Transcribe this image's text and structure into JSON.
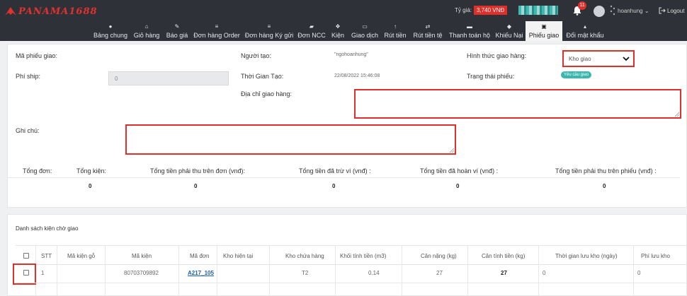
{
  "brand": {
    "name": "PANAMA1688"
  },
  "header": {
    "rate_label": "Tỷ giá:",
    "rate_value": "3,740 VNĐ",
    "notification_count": "11",
    "username": "hoanhung",
    "logout_label": "Logout"
  },
  "nav": [
    {
      "label": "Bảng chung",
      "icon": "dashboard-icon",
      "glyph": "●"
    },
    {
      "label": "Giỏ hàng",
      "icon": "basket-icon",
      "glyph": "⌂"
    },
    {
      "label": "Báo giá",
      "icon": "tag-icon",
      "glyph": "✎"
    },
    {
      "label": "Đơn hàng Order",
      "icon": "list-icon",
      "glyph": "≡"
    },
    {
      "label": "Đơn hàng Ký gửi",
      "icon": "list-icon",
      "glyph": "≡"
    },
    {
      "label": "Đơn NCC",
      "icon": "truck-icon",
      "glyph": "▰"
    },
    {
      "label": "Kiện",
      "icon": "cubes-icon",
      "glyph": "❖"
    },
    {
      "label": "Giao dịch",
      "icon": "calendar-icon",
      "glyph": "▭"
    },
    {
      "label": "Rút tiền",
      "icon": "arrow-up-icon",
      "glyph": "↑"
    },
    {
      "label": "Rút tiền tệ",
      "icon": "exchange-icon",
      "glyph": "⇄"
    },
    {
      "label": "Thanh toán hộ",
      "icon": "card-icon",
      "glyph": "▬"
    },
    {
      "label": "Khiếu Nại",
      "icon": "pin-icon",
      "glyph": "◆"
    },
    {
      "label": "Phiếu giao",
      "icon": "file-icon",
      "glyph": "▣"
    },
    {
      "label": "Đổi mật khẩu",
      "icon": "unlock-icon",
      "glyph": "▴"
    }
  ],
  "form": {
    "ma_phieu_label": "Mã phiếu giao:",
    "phi_ship_label": "Phí ship:",
    "phi_ship_value": "0",
    "nguoi_tao_label": "Người tạo:",
    "nguoi_tao_value": "\"ngohoanhung\"",
    "thoi_gian_label": "Thời Gian Tạo:",
    "thoi_gian_value": "22/08/2022 15:46:08",
    "dia_chi_label": "Địa chỉ giao hàng:",
    "hinh_thuc_label": "Hình thức giao hàng:",
    "hinh_thuc_value": "Kho giao",
    "trang_thai_label": "Trạng thái phiếu:",
    "trang_thai_value": "Yêu cầu giao",
    "ghi_chu_label": "Ghi chú:"
  },
  "summary": [
    {
      "label": "Tổng đơn:",
      "value": ""
    },
    {
      "label": "Tổng kiện:",
      "value": "0"
    },
    {
      "label": "Tổng tiền phải thu trên đơn (vnđ):",
      "value": "0"
    },
    {
      "label": "Tổng tiền đã trừ ví (vnđ) :",
      "value": "0"
    },
    {
      "label": "Tổng tiền đã hoàn ví (vnđ) :",
      "value": "0"
    },
    {
      "label": "Tổng tiền phải thu trên phiếu (vnđ) :",
      "value": "0"
    }
  ],
  "list": {
    "title": "Danh sách kiện chờ giao",
    "columns": [
      "STT",
      "Mã kiện gỗ",
      "Mã kiện",
      "Mã đơn",
      "Kho hiện tại",
      "Kho chứa hàng",
      "Khối tính tiền (m3)",
      "Cân nặng (kg)",
      "Cân tính tiền (kg)",
      "Thời gian lưu kho (ngày)",
      "Phí lưu kho"
    ],
    "rows": [
      {
        "stt": "1",
        "ma_kien_go": "",
        "ma_kien": "80703709892",
        "ma_don": "A217_105",
        "kho_hien_tai": "",
        "kho_chua_hang": "T2",
        "khoi": "0.14",
        "can_nang": "27",
        "can_tinh_tien": "27",
        "thoi_gian_luu": "0",
        "phi_luu_kho": "0"
      }
    ]
  },
  "colors": {
    "accent": "#e02e2a",
    "nav_bg": "#2e3238",
    "teal": "#3ab7ad",
    "link": "#1a5fb4"
  }
}
